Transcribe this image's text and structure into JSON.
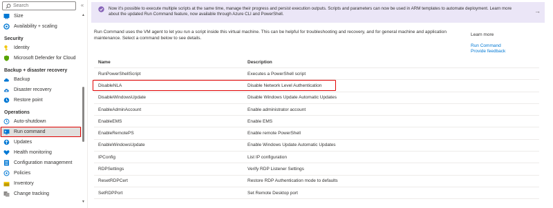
{
  "sidebar": {
    "search_placeholder": "Search",
    "collapse_label": "«",
    "items_top": [
      {
        "label": "Size",
        "icon": "size-icon"
      },
      {
        "label": "Availability + scaling",
        "icon": "availability-icon"
      }
    ],
    "sections": [
      {
        "title": "Security",
        "items": [
          {
            "label": "Identity",
            "icon": "identity-icon"
          },
          {
            "label": "Microsoft Defender for Cloud",
            "icon": "defender-icon"
          }
        ]
      },
      {
        "title": "Backup + disaster recovery",
        "items": [
          {
            "label": "Backup",
            "icon": "backup-icon"
          },
          {
            "label": "Disaster recovery",
            "icon": "disaster-recovery-icon"
          },
          {
            "label": "Restore point",
            "icon": "restore-point-icon"
          }
        ]
      },
      {
        "title": "Operations",
        "items": [
          {
            "label": "Auto-shutdown",
            "icon": "clock-icon"
          },
          {
            "label": "Run command",
            "icon": "run-command-icon",
            "selected": true
          },
          {
            "label": "Updates",
            "icon": "updates-icon"
          },
          {
            "label": "Health monitoring",
            "icon": "health-icon"
          },
          {
            "label": "Configuration management",
            "icon": "config-icon"
          },
          {
            "label": "Policies",
            "icon": "policies-icon"
          },
          {
            "label": "Inventory",
            "icon": "inventory-icon"
          },
          {
            "label": "Change tracking",
            "icon": "change-tracking-icon"
          }
        ]
      }
    ]
  },
  "banner": {
    "text": "Now it's possible to execute multiple scripts at the same time, manage their progress and persist execution outputs. Scripts and parameters can now be used in ARM templates to automate deployment. Learn more about the updated Run Command feature, now available through Azure CLI and PowerShell.",
    "arrow": "→"
  },
  "main": {
    "description": "Run Command uses the VM agent to let you run a script inside this virtual machine. This can be helpful for troubleshooting and recovery, and for general machine and application maintenance. Select a command below to see details.",
    "learn_more": "Learn more",
    "links": [
      "Run Command",
      "Provide feedback"
    ],
    "table": {
      "headers": [
        "Name",
        "Description"
      ],
      "rows": [
        [
          "RunPowerShellScript",
          "Executes a PowerShell script"
        ],
        [
          "DisableNLA",
          "Disable Network Level Authentication"
        ],
        [
          "DisableWindowsUpdate",
          "Disable Windows Update Automatic Updates"
        ],
        [
          "EnableAdminAccount",
          "Enable administrator account"
        ],
        [
          "EnableEMS",
          "Enable EMS"
        ],
        [
          "EnableRemotePS",
          "Enable remote PowerShell"
        ],
        [
          "EnableWindowsUpdate",
          "Enable Windows Update Automatic Updates"
        ],
        [
          "IPConfig",
          "List IP configuration"
        ],
        [
          "RDPSettings",
          "Verify RDP Listener Settings"
        ],
        [
          "ResetRDPCert",
          "Restore RDP Authentication mode to defaults"
        ],
        [
          "SetRDPPort",
          "Set Remote Desktop port"
        ]
      ],
      "highlighted_row": "DisableNLA"
    }
  },
  "colors": {
    "highlight": "#e00000",
    "link": "#0078d4",
    "banner_bg": "#ebe6f7",
    "selected_bg": "#e1dfdd"
  }
}
